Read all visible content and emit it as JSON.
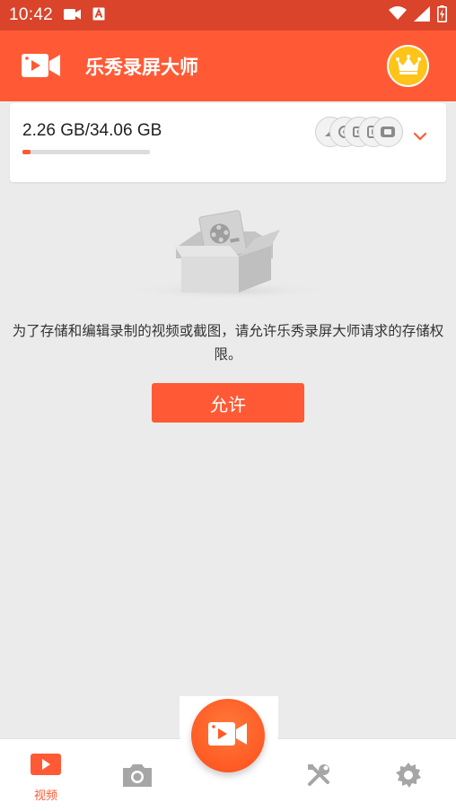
{
  "status_bar": {
    "time": "10:42",
    "left_icons": [
      "camera-record-icon",
      "app-a-icon"
    ],
    "right_icons": [
      "wifi-icon",
      "signal-icon",
      "battery-charging-icon"
    ]
  },
  "app_bar": {
    "title": "乐秀录屏大师",
    "logo": "video-camera-icon",
    "crown": "crown-icon",
    "background": "#ff5a35"
  },
  "storage": {
    "text": "2.26 GB/34.06 GB",
    "used_fraction": 0.066,
    "formats": [
      "format-icon-1",
      "format-icon-2",
      "format-icon-3",
      "format-icon-4",
      "format-icon-5"
    ],
    "expand_icon": "chevron-down-icon"
  },
  "empty_state": {
    "message": "为了存储和编辑录制的视频或截图，请允许乐秀录屏大师请求的存储权限。",
    "button_label": "允许"
  },
  "bottom_nav": {
    "tabs": [
      {
        "label": "视频",
        "icon": "video-play-icon",
        "active": true
      },
      {
        "label": "",
        "icon": "camera-icon",
        "active": false
      },
      {
        "label": "",
        "icon": "tools-icon",
        "active": false
      },
      {
        "label": "",
        "icon": "settings-gear-icon",
        "active": false
      }
    ],
    "fab_icon": "record-video-icon"
  },
  "colors": {
    "accent": "#ff5a35",
    "status_bar": "#d9442a",
    "background": "#ebebeb"
  }
}
